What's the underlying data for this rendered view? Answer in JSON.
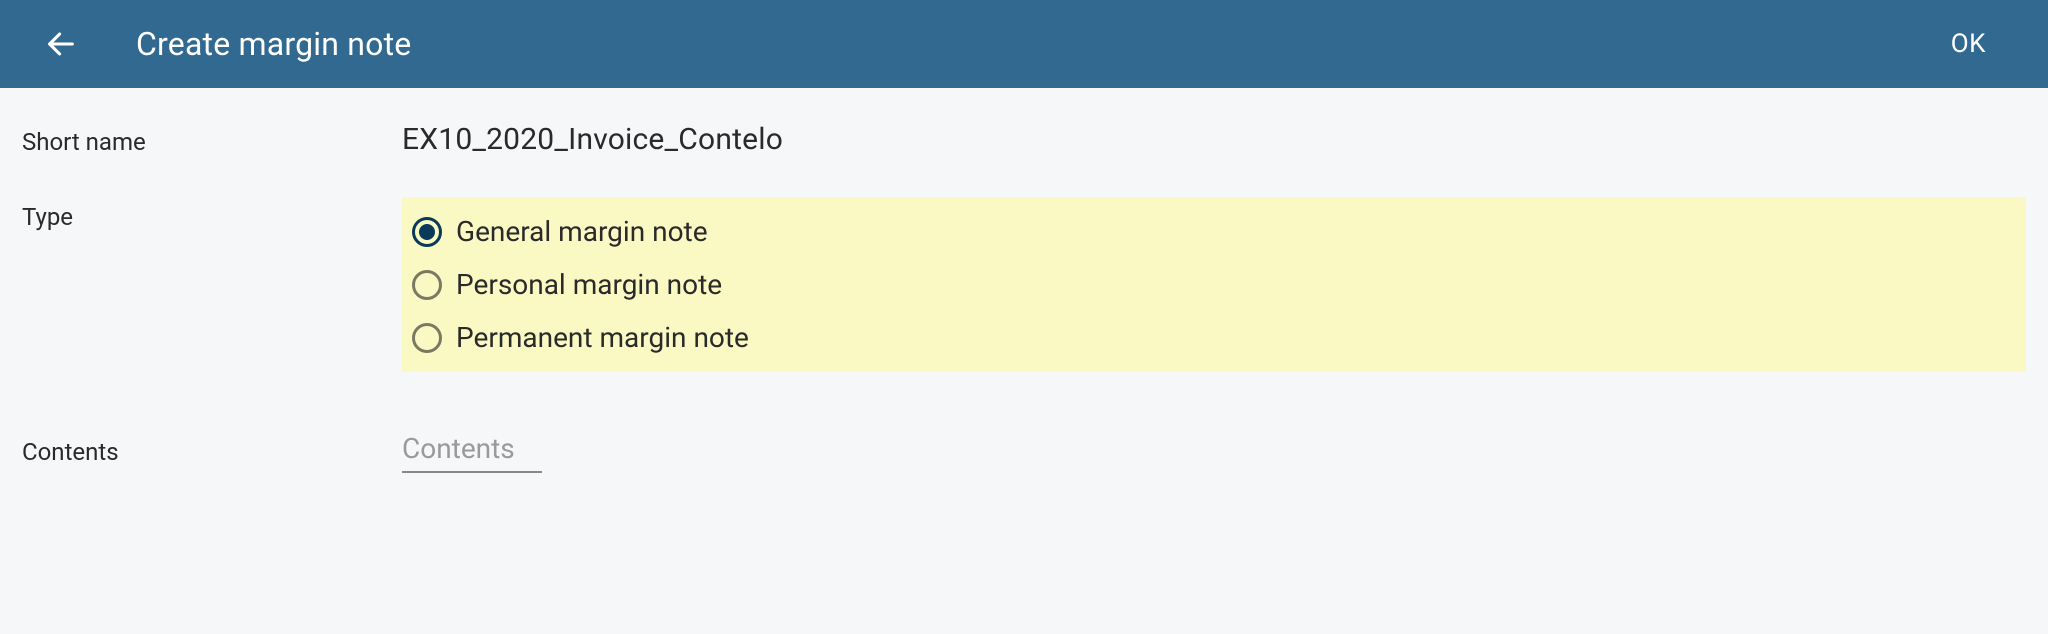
{
  "header": {
    "title": "Create margin note",
    "ok_label": "OK"
  },
  "form": {
    "short_name": {
      "label": "Short name",
      "value": "EX10_2020_Invoice_Contelo"
    },
    "type": {
      "label": "Type",
      "options": [
        {
          "label": "General margin note",
          "selected": true
        },
        {
          "label": "Personal margin note",
          "selected": false
        },
        {
          "label": "Permanent margin note",
          "selected": false
        }
      ]
    },
    "contents": {
      "label": "Contents",
      "placeholder": "Contents",
      "value": ""
    }
  }
}
